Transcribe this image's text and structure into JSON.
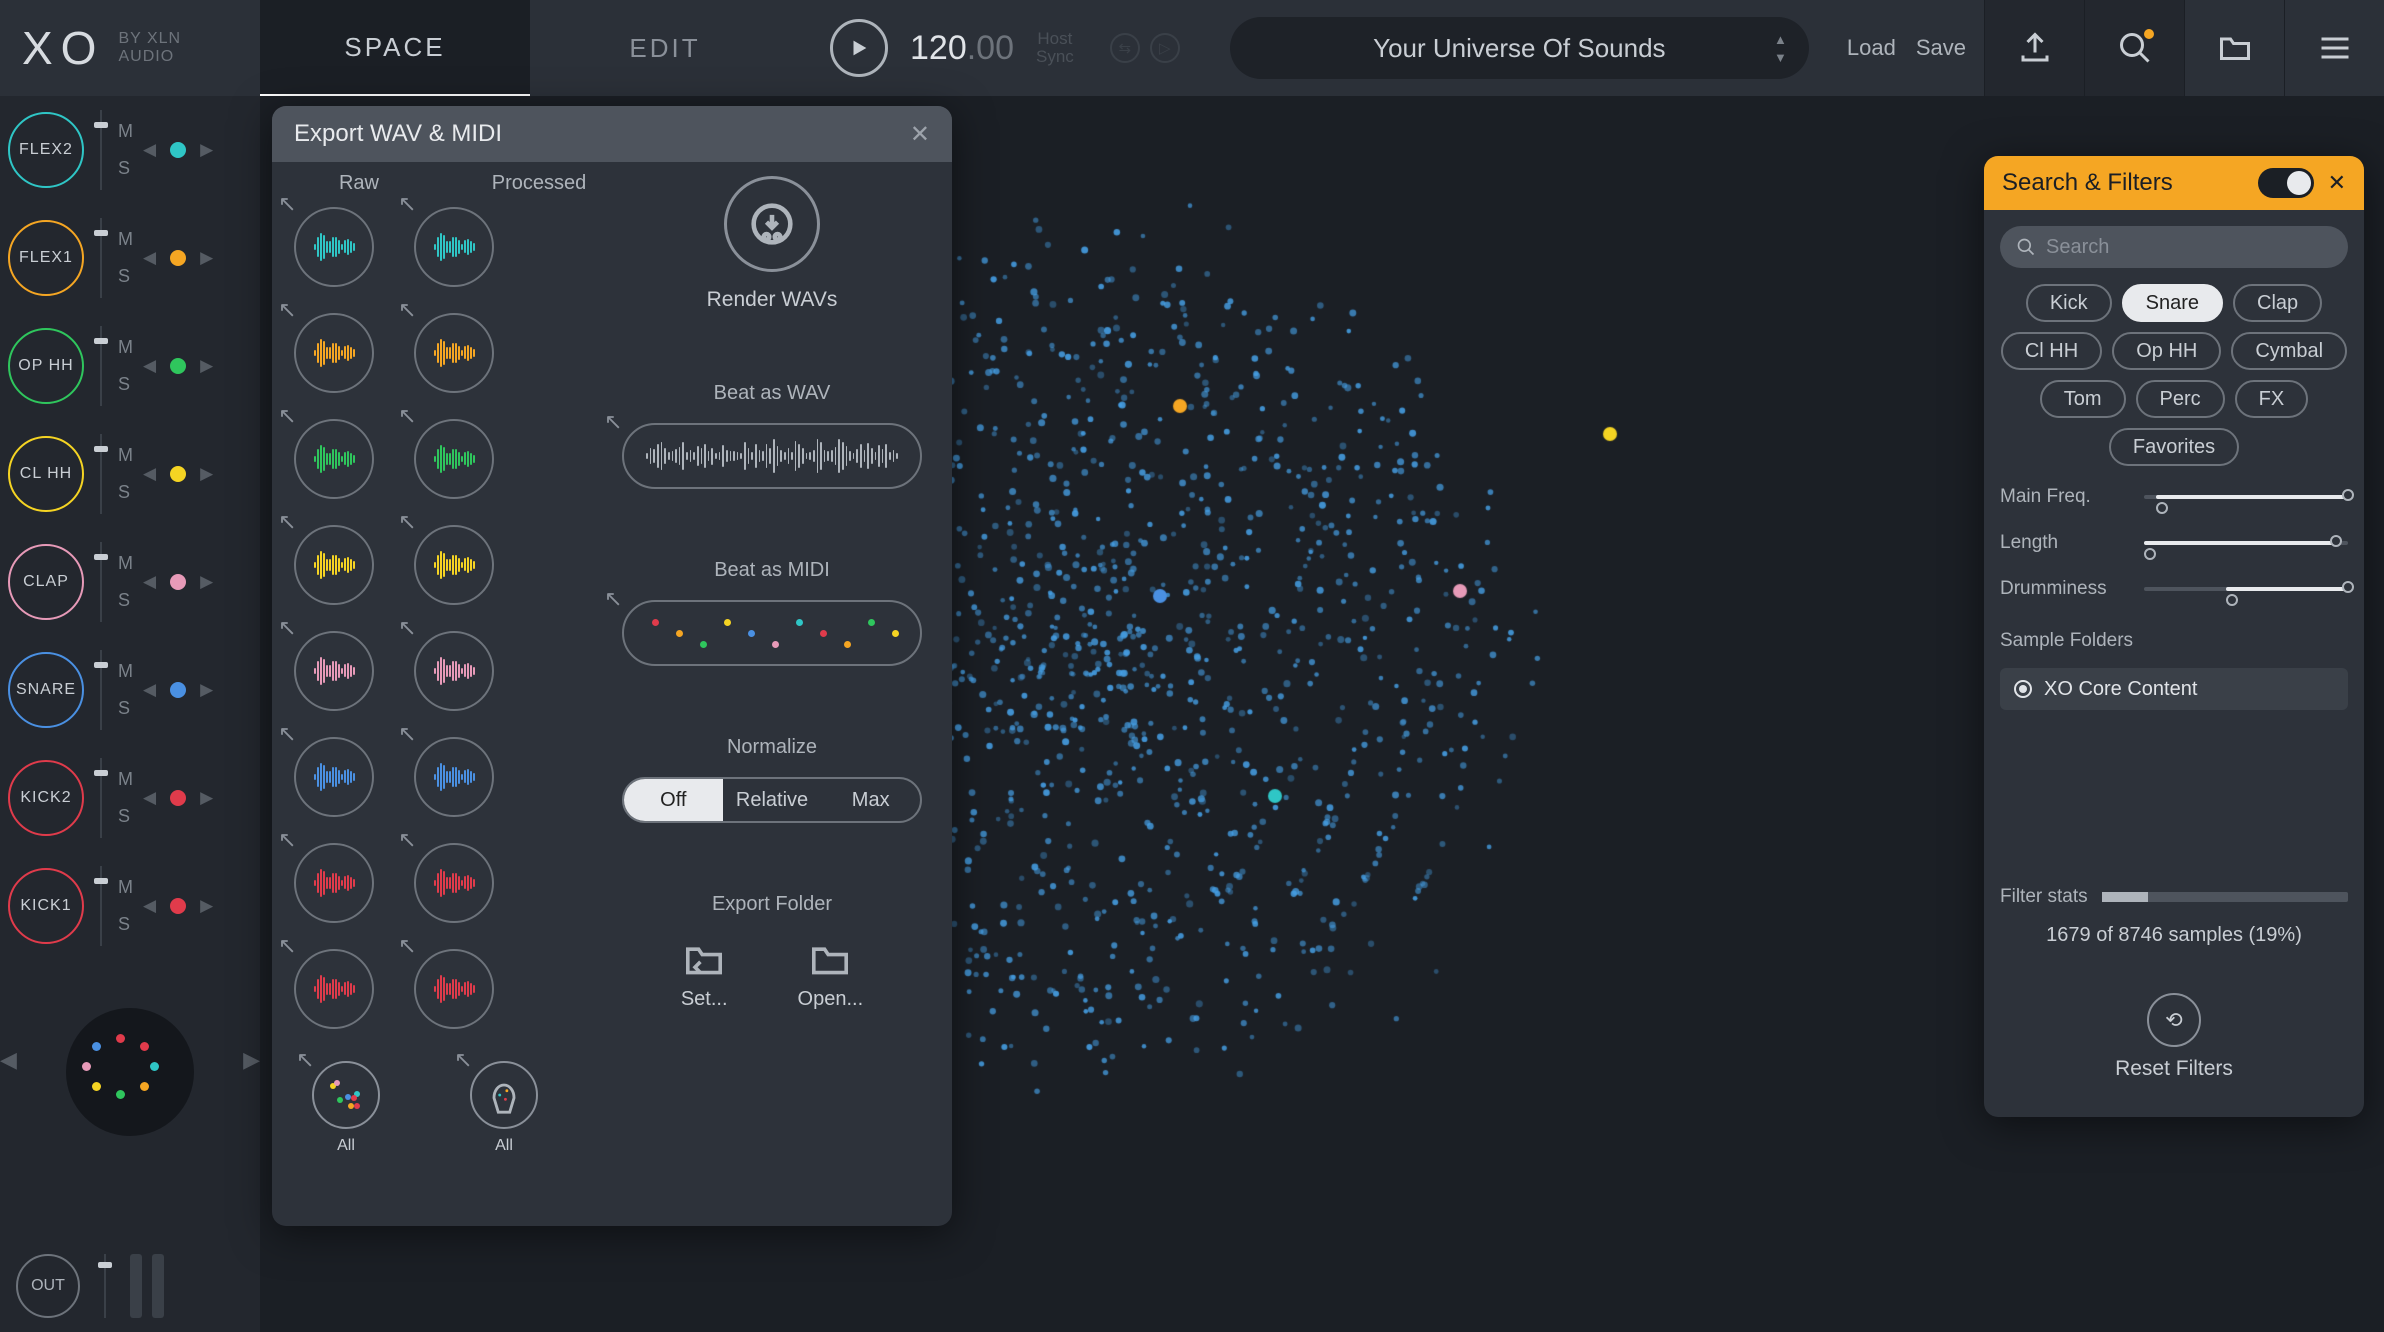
{
  "header": {
    "logo_main": "XO",
    "logo_sub1": "BY XLN",
    "logo_sub2": "AUDIO",
    "tab_space": "SPACE",
    "tab_edit": "EDIT",
    "tempo_int": "120",
    "tempo_dec": ".00",
    "host": "Host",
    "sync": "Sync",
    "preset": "Your Universe Of Sounds",
    "load": "Load",
    "save": "Save"
  },
  "channels": [
    {
      "name": "FLEX2",
      "color": "#2fc6c6"
    },
    {
      "name": "FLEX1",
      "color": "#f5a623"
    },
    {
      "name": "OP HH",
      "color": "#2fc65d"
    },
    {
      "name": "CL HH",
      "color": "#f5d423"
    },
    {
      "name": "CLAP",
      "color": "#e79ab8"
    },
    {
      "name": "SNARE",
      "color": "#4a90e2"
    },
    {
      "name": "KICK2",
      "color": "#e03b4b"
    },
    {
      "name": "KICK1",
      "color": "#e03b4b"
    }
  ],
  "channel_static": {
    "mute": "M",
    "solo": "S"
  },
  "out_label": "OUT",
  "export": {
    "title": "Export WAV & MIDI",
    "col_raw": "Raw",
    "col_processed": "Processed",
    "all": "All",
    "render": "Render WAVs",
    "beat_wav": "Beat as WAV",
    "beat_midi": "Beat as MIDI",
    "normalize": "Normalize",
    "norm_opts": [
      "Off",
      "Relative",
      "Max"
    ],
    "folder": "Export Folder",
    "set": "Set...",
    "open": "Open..."
  },
  "filters": {
    "title": "Search & Filters",
    "search_placeholder": "Search",
    "tags": [
      "Kick",
      "Snare",
      "Clap",
      "Cl HH",
      "Op HH",
      "Cymbal",
      "Tom",
      "Perc",
      "FX",
      "Favorites"
    ],
    "active_tag": "Snare",
    "slider_mainfreq": "Main Freq.",
    "slider_length": "Length",
    "slider_drumminess": "Drumminess",
    "folders_label": "Sample Folders",
    "folder0": "XO Core Content",
    "stats_label": "Filter stats",
    "stats_line": "1679 of 8746 samples (19%)",
    "reset": "Reset Filters"
  }
}
